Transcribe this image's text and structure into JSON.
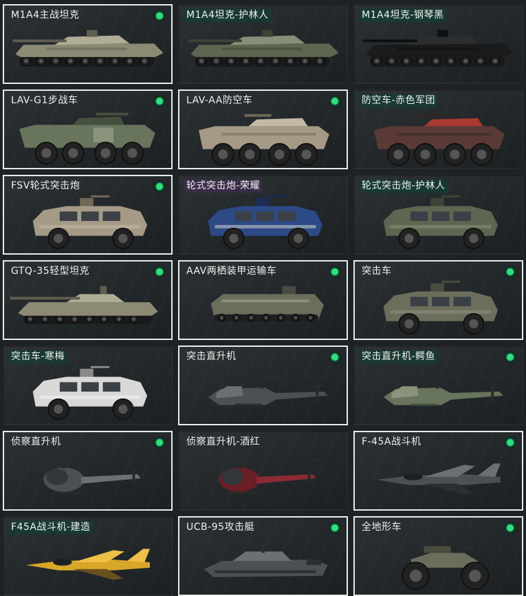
{
  "vehicles": [
    {
      "name": "M1A4主战坦克",
      "owned": true,
      "badge": true,
      "highlight": "",
      "icon": "tank-icon",
      "camo": "desert"
    },
    {
      "name": "M1A4坦克-护林人",
      "owned": false,
      "badge": false,
      "highlight": "green",
      "icon": "tank-icon",
      "camo": "woodland"
    },
    {
      "name": "M1A4坦克-钢琴黑",
      "owned": false,
      "badge": false,
      "highlight": "green",
      "icon": "tank-icon",
      "camo": "black"
    },
    {
      "name": "LAV-G1步战车",
      "owned": true,
      "badge": true,
      "highlight": "",
      "icon": "ifv-icon",
      "camo": "green"
    },
    {
      "name": "LAV-AA防空车",
      "owned": true,
      "badge": true,
      "highlight": "",
      "icon": "aa-vehicle-icon",
      "camo": "tan"
    },
    {
      "name": "防空车-赤色军团",
      "owned": false,
      "badge": false,
      "highlight": "green",
      "icon": "aa-vehicle-icon",
      "camo": "red"
    },
    {
      "name": "FSV轮式突击炮",
      "owned": true,
      "badge": true,
      "highlight": "",
      "icon": "armored-car-icon",
      "camo": "tan"
    },
    {
      "name": "轮式突击炮-荣耀",
      "owned": false,
      "badge": false,
      "highlight": "purple",
      "icon": "armored-car-icon",
      "camo": "blue"
    },
    {
      "name": "轮式突击炮-护林人",
      "owned": false,
      "badge": false,
      "highlight": "green",
      "icon": "armored-car-icon",
      "camo": "woodland"
    },
    {
      "name": "GTQ-35轻型坦克",
      "owned": true,
      "badge": true,
      "highlight": "",
      "icon": "light-tank-icon",
      "camo": "desert"
    },
    {
      "name": "AAV两栖装甲运输车",
      "owned": true,
      "badge": true,
      "highlight": "",
      "icon": "amphibious-vehicle-icon",
      "camo": "olive"
    },
    {
      "name": "突击车",
      "owned": true,
      "badge": true,
      "highlight": "",
      "icon": "assault-vehicle-icon",
      "camo": "olive"
    },
    {
      "name": "突击车-寒梅",
      "owned": false,
      "badge": false,
      "highlight": "green",
      "icon": "assault-vehicle-icon",
      "camo": "white"
    },
    {
      "name": "突击直升机",
      "owned": true,
      "badge": true,
      "highlight": "",
      "icon": "attack-helicopter-icon",
      "camo": "gray"
    },
    {
      "name": "突击直升机-鳄鱼",
      "owned": false,
      "badge": true,
      "highlight": "green",
      "icon": "attack-helicopter-icon",
      "camo": "green"
    },
    {
      "name": "侦察直升机",
      "owned": true,
      "badge": true,
      "highlight": "",
      "icon": "scout-helicopter-icon",
      "camo": "gray"
    },
    {
      "name": "侦察直升机-酒红",
      "owned": false,
      "badge": false,
      "highlight": "",
      "icon": "scout-helicopter-icon",
      "camo": "wine"
    },
    {
      "name": "F-45A战斗机",
      "owned": true,
      "badge": true,
      "highlight": "",
      "icon": "fighter-jet-icon",
      "camo": "gray"
    },
    {
      "name": "F45A战斗机-建造",
      "owned": false,
      "badge": false,
      "highlight": "green",
      "icon": "fighter-jet-icon",
      "camo": "yellow"
    },
    {
      "name": "UCB-95攻击艇",
      "owned": true,
      "badge": true,
      "highlight": "",
      "icon": "attack-boat-icon",
      "camo": "gray"
    },
    {
      "name": "全地形车",
      "owned": true,
      "badge": true,
      "highlight": "",
      "icon": "atv-icon",
      "camo": "olive"
    }
  ],
  "colors": {
    "owned_border": "#e9eceb",
    "badge_dot": "#2ee07f",
    "label_highlight_green": "#163c34",
    "label_highlight_purple": "#3e2c4e",
    "background": "#1f2224"
  }
}
